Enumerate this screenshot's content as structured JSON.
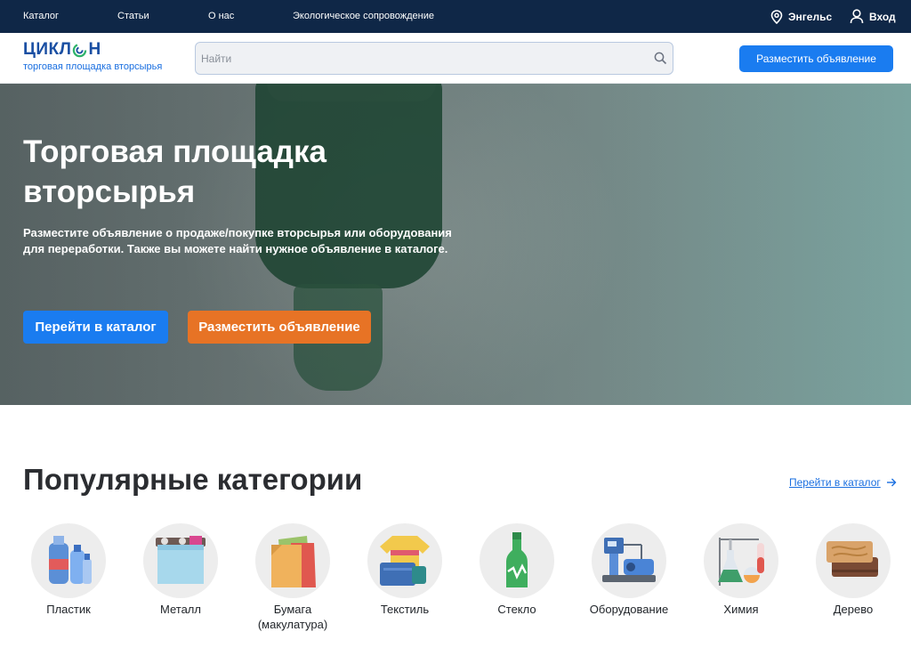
{
  "topbar": {
    "nav": [
      "Каталог",
      "Статьи",
      "О нас",
      "Экологическое сопровождение"
    ],
    "city": "Энгельс",
    "login": "Вход"
  },
  "header": {
    "logo_word_start": "ЦИКЛ",
    "logo_word_end": "Н",
    "logo_sub": "торговая площадка вторсырья",
    "search_placeholder": "Найти",
    "post_button": "Разместить объявление"
  },
  "hero": {
    "title": "Торговая площадка вторсырья",
    "text": "Разместите объявление о продаже/покупке вторсырья или оборудования для переработки. Также вы можете найти нужное объявление в каталоге.",
    "catalog_button": "Перейти в каталог",
    "post_button": "Разместить объявление"
  },
  "categories": {
    "title": "Популярные категории",
    "link": "Перейти в каталог",
    "items": [
      {
        "label": "Пластик",
        "icon": "plastic-bottles-icon"
      },
      {
        "label": "Металл",
        "icon": "metal-scrap-icon"
      },
      {
        "label": "Бумага (макулатура)",
        "icon": "paper-icon"
      },
      {
        "label": "Текстиль",
        "icon": "textile-icon"
      },
      {
        "label": "Стекло",
        "icon": "glass-bottle-icon"
      },
      {
        "label": "Оборудование",
        "icon": "equipment-icon"
      },
      {
        "label": "Химия",
        "icon": "chemistry-icon"
      },
      {
        "label": "Дерево",
        "icon": "wood-icon"
      }
    ]
  },
  "colors": {
    "topbar": "#0f2747",
    "primary": "#1a7cf0",
    "accent_orange": "#e77325",
    "logo_blue": "#1a4fa3",
    "logo_green": "#2fb36b"
  }
}
